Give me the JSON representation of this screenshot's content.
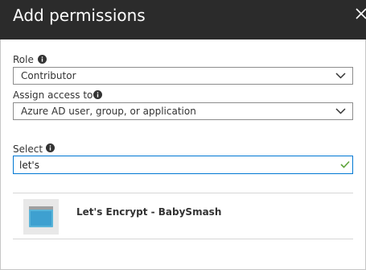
{
  "header": {
    "title": "Add permissions"
  },
  "role": {
    "label": "Role",
    "value": "Contributor"
  },
  "assign": {
    "label": "Assign access to",
    "value": "Azure AD user, group, or application"
  },
  "select": {
    "label": "Select",
    "value": "let's"
  },
  "results": [
    {
      "name": "Let's Encrypt - BabySmash"
    }
  ],
  "colors": {
    "header_bg": "#2b2b2b",
    "accent": "#0078d4",
    "valid": "#5ea43a"
  },
  "icons": [
    "close-icon",
    "info-icon",
    "chevron-down-icon",
    "checkmark-icon",
    "app-icon"
  ]
}
